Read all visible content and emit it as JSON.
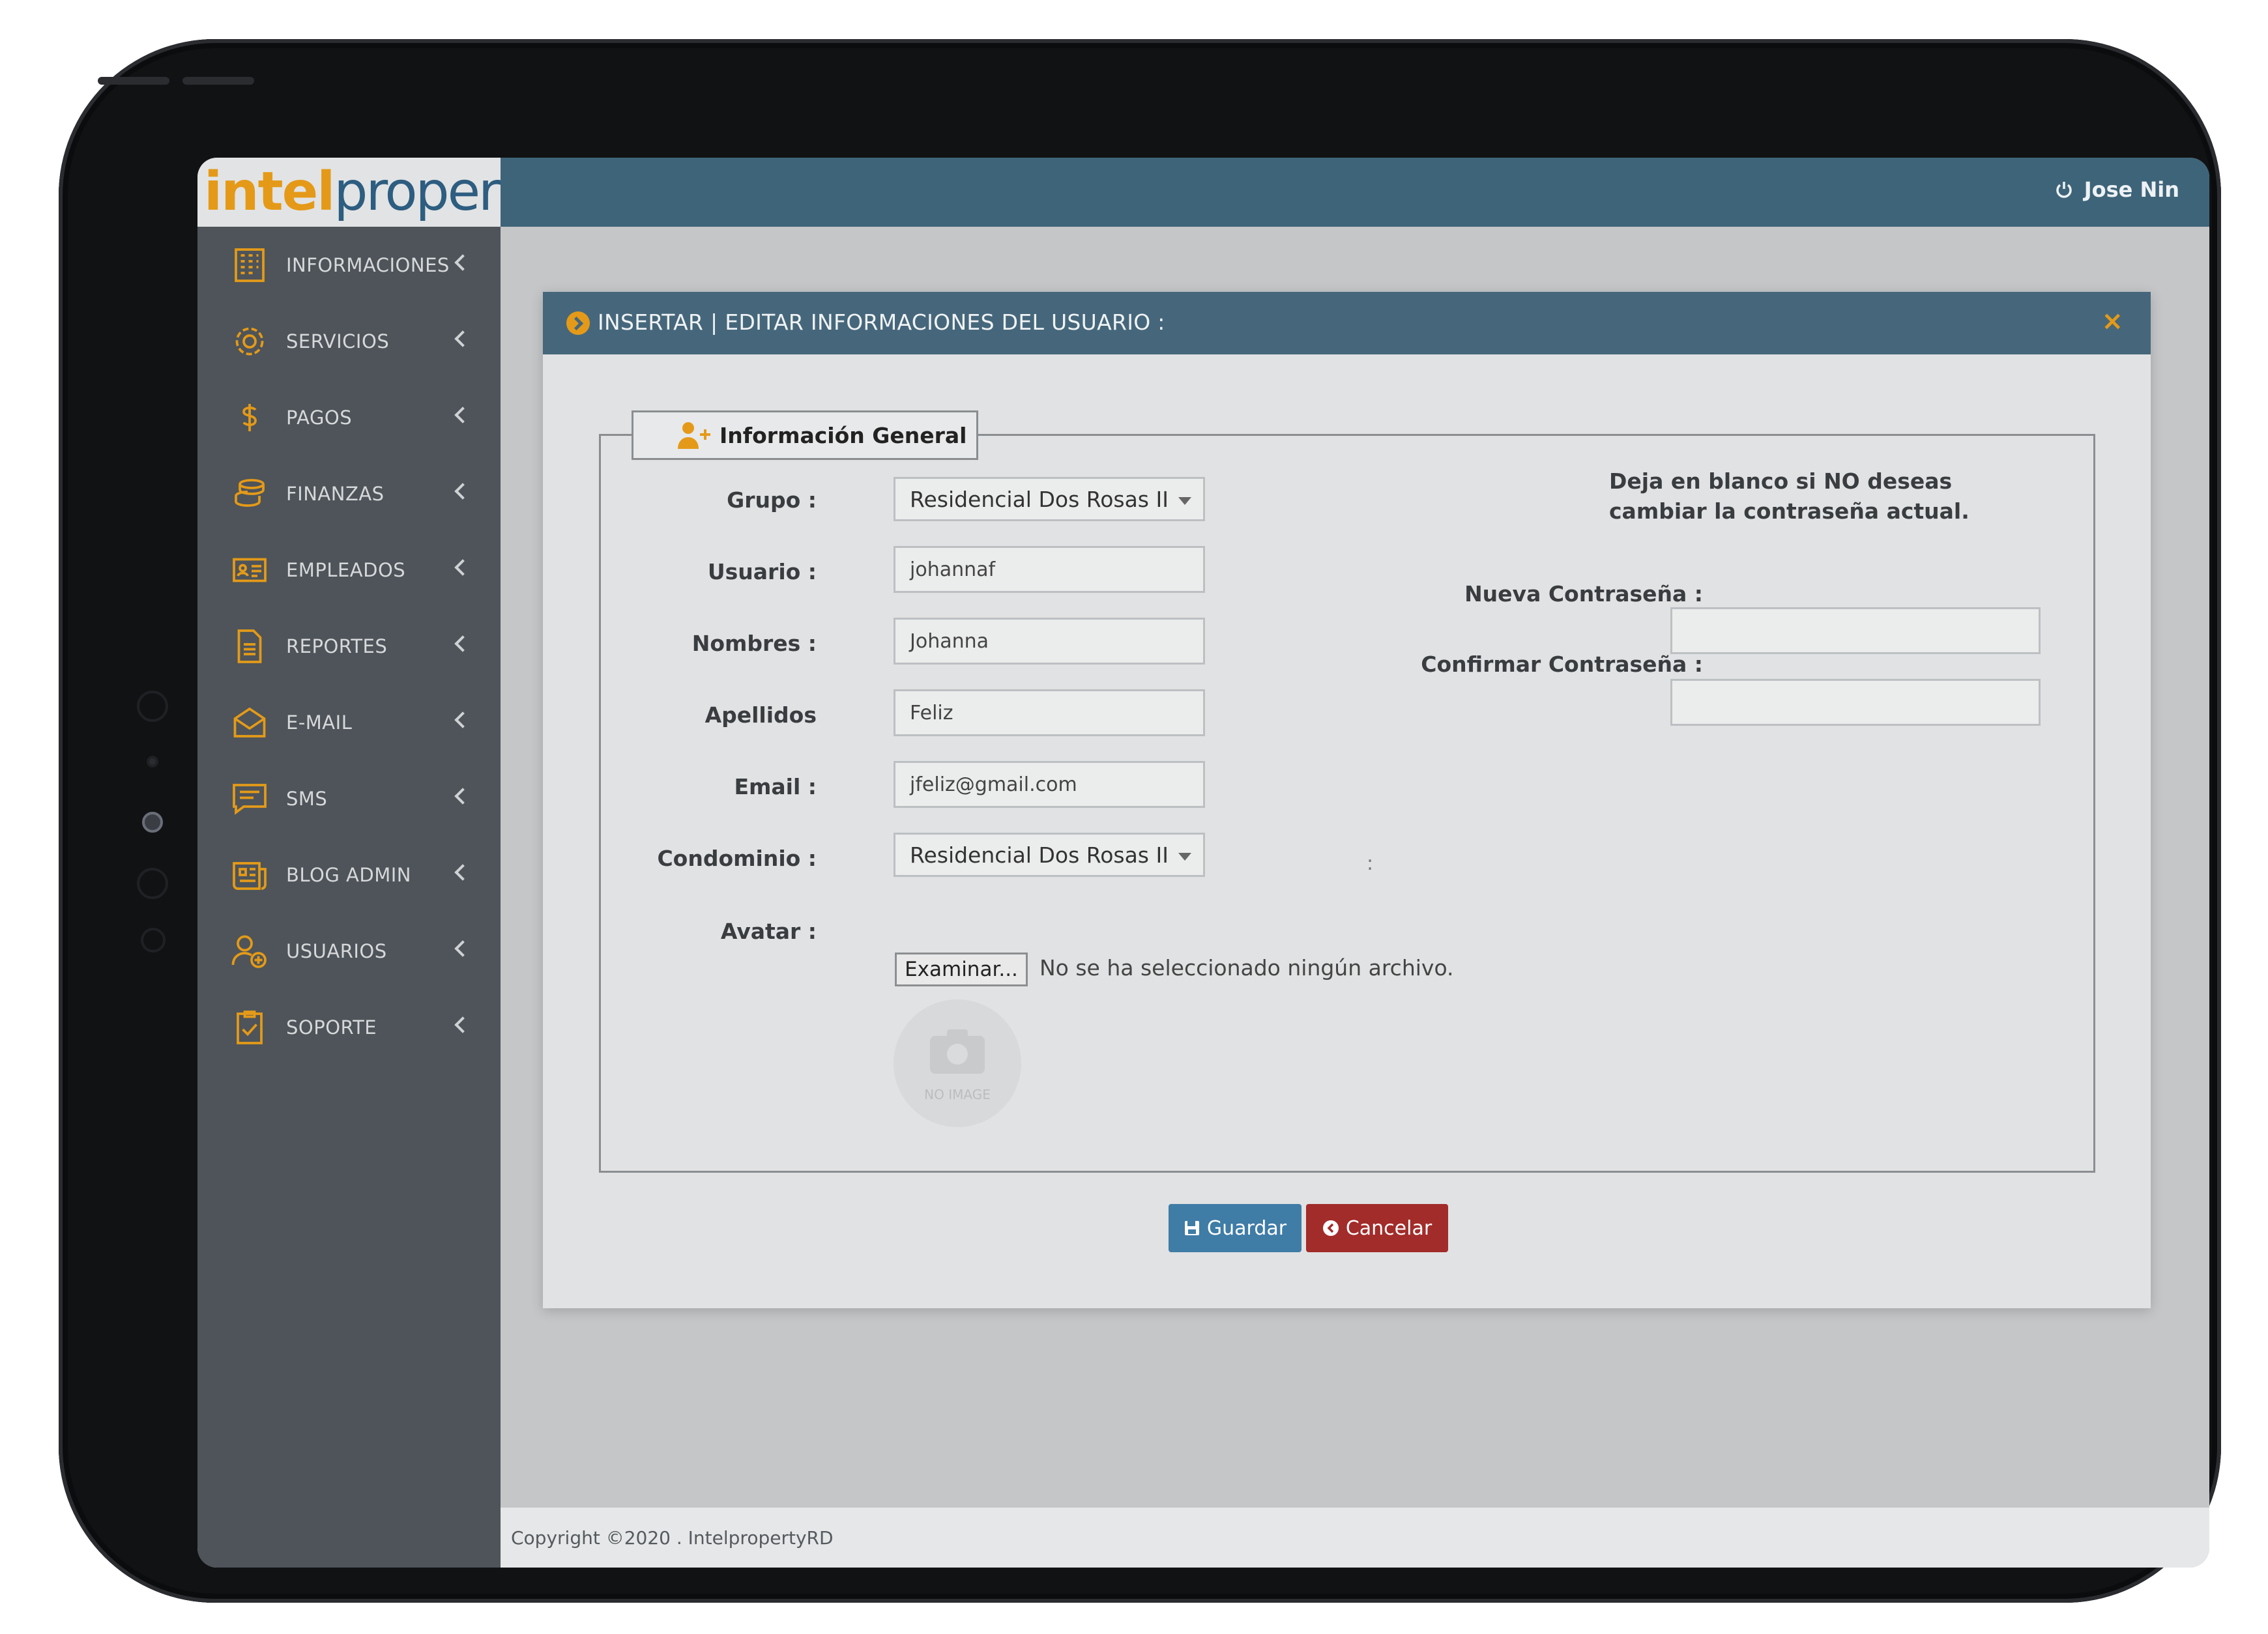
{
  "brand": {
    "part1": "intel",
    "part2": "property"
  },
  "header": {
    "user_name": "Jose Nin"
  },
  "sidebar": {
    "items": [
      {
        "label": "INFORMACIONES",
        "icon": "building-icon"
      },
      {
        "label": "SERVICIOS",
        "icon": "gear-icon"
      },
      {
        "label": "PAGOS",
        "icon": "dollar-icon"
      },
      {
        "label": "FINANZAS",
        "icon": "coins-icon"
      },
      {
        "label": "EMPLEADOS",
        "icon": "id-card-icon"
      },
      {
        "label": "REPORTES",
        "icon": "document-icon"
      },
      {
        "label": "E-MAIL",
        "icon": "envelope-icon"
      },
      {
        "label": "SMS",
        "icon": "message-icon"
      },
      {
        "label": "BLOG ADMIN",
        "icon": "newspaper-icon"
      },
      {
        "label": "USUARIOS",
        "icon": "add-user-icon"
      },
      {
        "label": "SOPORTE",
        "icon": "clipboard-check-icon"
      }
    ]
  },
  "modal": {
    "title": "INSERTAR | EDITAR INFORMACIONES DEL USUARIO :",
    "close_label": "×",
    "legend": "Información General",
    "labels": {
      "grupo": "Grupo :",
      "usuario": "Usuario :",
      "nombres": "Nombres :",
      "apellidos": "Apellidos",
      "email": "Email :",
      "condominio": "Condominio :",
      "avatar": "Avatar :",
      "nueva": "Nueva Contraseña :",
      "confirmar": "Confirmar Contraseña :"
    },
    "values": {
      "grupo": "Residencial Dos Rosas II",
      "usuario": "johannaf",
      "nombres": "Johanna",
      "apellidos": "Feliz",
      "email": "jfeliz@gmail.com",
      "condominio": "Residencial Dos Rosas II",
      "nueva": "",
      "confirmar": ""
    },
    "stray_colon": ":",
    "hint": "Deja en blanco si NO deseas cambiar la contraseña actual.",
    "browse_label": "Examinar...",
    "no_file": "No se ha seleccionado ningún archivo.",
    "no_image": "NO IMAGE",
    "save_label": "Guardar",
    "cancel_label": "Cancelar"
  },
  "footer": {
    "copyright": "Copyright ©2020 . IntelpropertyRD"
  },
  "colors": {
    "accent": "#e49a18",
    "header": "#3e6479",
    "sidebar": "#4e5459",
    "save": "#3f7ca6",
    "cancel": "#a22c2a"
  }
}
